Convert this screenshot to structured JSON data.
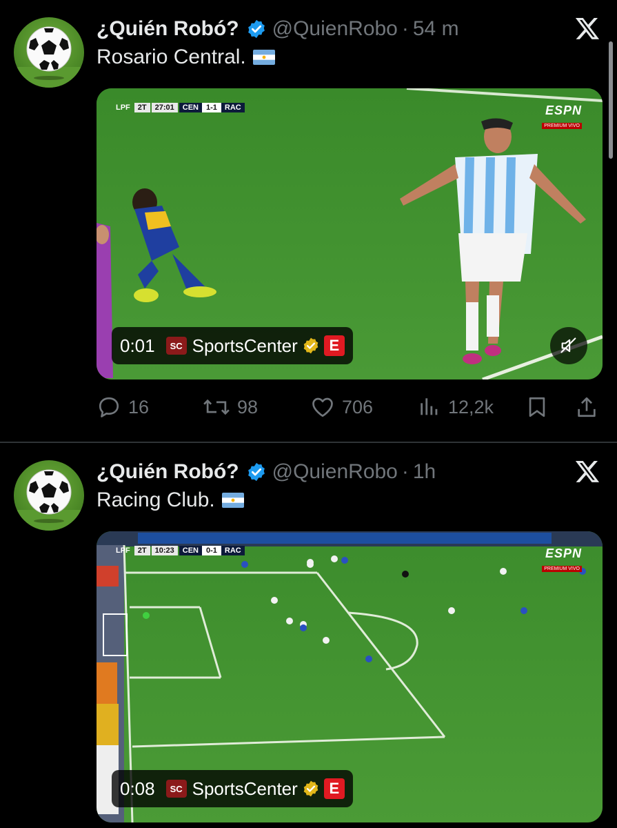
{
  "tweets": [
    {
      "author": {
        "name": "¿Quién Robó?",
        "handle": "@QuienRobo",
        "verified": true,
        "avatar_icon": "soccer-ball-icon"
      },
      "time": "54 m",
      "separator": "·",
      "text": "Rosario Central.",
      "flag_icon": "argentina-flag-icon",
      "media": {
        "duration": "0:01",
        "source": "SportsCenter",
        "source_icon": "sc-logo",
        "scorebug": {
          "league": "LPF",
          "half": "2T",
          "clock": "27:01",
          "home": "CEN",
          "score": "1-1",
          "away": "RAC"
        },
        "broadcaster": "ESPN",
        "broadcaster_sub": "PREMIUM VIVO",
        "muted": true
      },
      "stats": {
        "replies": "16",
        "retweets": "98",
        "likes": "706",
        "views": "12,2k"
      }
    },
    {
      "author": {
        "name": "¿Quién Robó?",
        "handle": "@QuienRobo",
        "verified": true,
        "avatar_icon": "soccer-ball-icon"
      },
      "time": "1h",
      "separator": "·",
      "text": "Racing Club.",
      "flag_icon": "argentina-flag-icon",
      "media": {
        "duration": "0:08",
        "source": "SportsCenter",
        "source_icon": "sc-logo",
        "scorebug": {
          "league": "LPF",
          "half": "2T",
          "clock": "10:23",
          "home": "CEN",
          "score": "0-1",
          "away": "RAC"
        },
        "broadcaster": "ESPN",
        "broadcaster_sub": "PREMIUM VIVO"
      }
    }
  ],
  "colors": {
    "background": "#000000",
    "text": "#e7e9ea",
    "muted": "#71767b",
    "verified": "#1d9bf0",
    "divider": "#2f3336"
  }
}
